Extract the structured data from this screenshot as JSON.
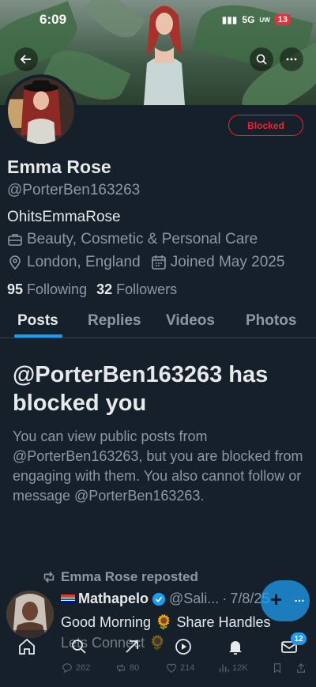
{
  "status_bar": {
    "time": "6:09",
    "network": "5G",
    "network_sub": "UW",
    "battery": "13"
  },
  "profile": {
    "display_name": "Emma Rose",
    "handle": "@PorterBen163263",
    "bio": "OhitsEmmaRose",
    "category": "Beauty, Cosmetic & Personal Care",
    "location": "London, England",
    "joined": "Joined May 2025",
    "following_count": "95",
    "following_label": "Following",
    "followers_count": "32",
    "followers_label": "Followers",
    "blocked_button": "Blocked"
  },
  "tabs": [
    {
      "label": "Posts",
      "active": true
    },
    {
      "label": "Replies",
      "active": false
    },
    {
      "label": "Videos",
      "active": false
    },
    {
      "label": "Photos",
      "active": false
    }
  ],
  "blocked_notice": {
    "title": "@PorterBen163263 has blocked you",
    "description": "You can view public posts from @PorterBen163263, but you are blocked from engaging with them. You also cannot follow or message @PorterBen163263."
  },
  "post": {
    "repost_label": "Emma Rose reposted",
    "author_name": "Mathapelo",
    "author_handle": "@Sali...",
    "date": "7/8/25",
    "text": "Good Morning 🌻 Share Handles Lets Connect 🌻",
    "replies": "262",
    "reposts": "80",
    "likes": "214",
    "views": "12K"
  },
  "bottom_nav": {
    "messages_badge": "12"
  },
  "icons": [
    "back-arrow-icon",
    "search-icon",
    "more-icon",
    "briefcase-icon",
    "location-pin-icon",
    "calendar-icon",
    "repost-icon",
    "verified-icon",
    "home-icon",
    "search-nav-icon",
    "grok-icon",
    "play-icon",
    "bell-icon",
    "mail-icon",
    "plus-icon"
  ],
  "colors": {
    "background": "#15202b",
    "accent": "#1d9bf0",
    "blocked": "#f4212e",
    "muted": "#8b98a5",
    "text": "#e7e9ea"
  }
}
